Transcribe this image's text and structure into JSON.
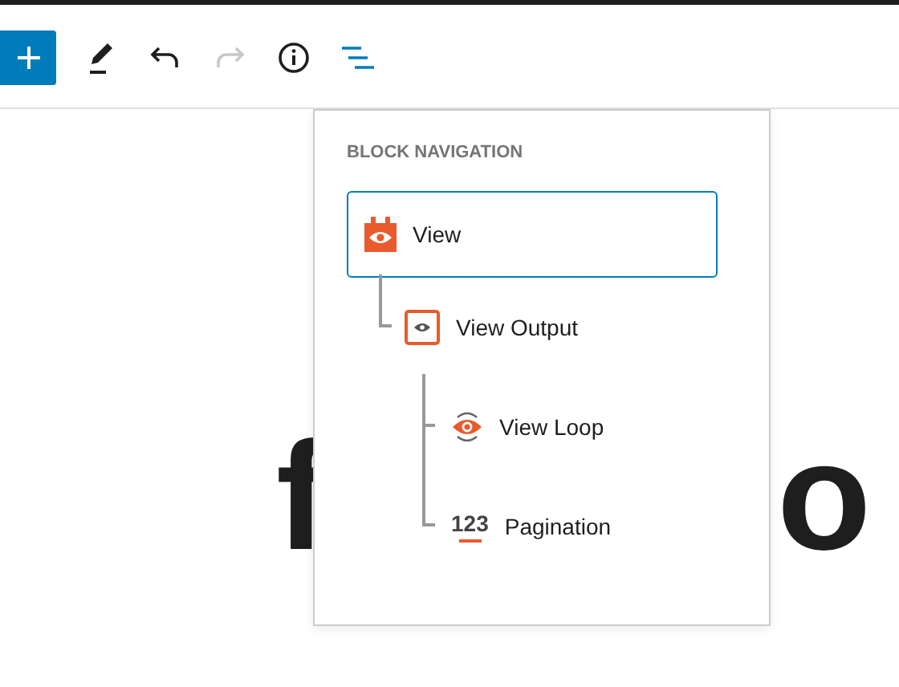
{
  "toolbar": {
    "tools": [
      {
        "kind": "add",
        "disabled": false,
        "selected": false
      },
      {
        "kind": "edit",
        "disabled": false,
        "selected": false
      },
      {
        "kind": "undo",
        "disabled": false,
        "selected": false
      },
      {
        "kind": "redo",
        "disabled": true,
        "selected": false
      },
      {
        "kind": "info",
        "disabled": false,
        "selected": false
      },
      {
        "kind": "list",
        "disabled": false,
        "selected": true
      }
    ]
  },
  "background_heading": {
    "fragments": [
      "f",
      "o"
    ]
  },
  "block_navigation": {
    "title": "BLOCK NAVIGATION",
    "items": [
      {
        "label": "View",
        "kind": "view",
        "selected": true,
        "children": [
          {
            "label": "View Output",
            "kind": "output",
            "selected": false,
            "children": [
              {
                "label": "View Loop",
                "kind": "loop",
                "selected": false
              },
              {
                "label": "Pagination",
                "kind": "pagination",
                "selected": false,
                "icon_text": "123"
              }
            ]
          }
        ]
      }
    ]
  }
}
